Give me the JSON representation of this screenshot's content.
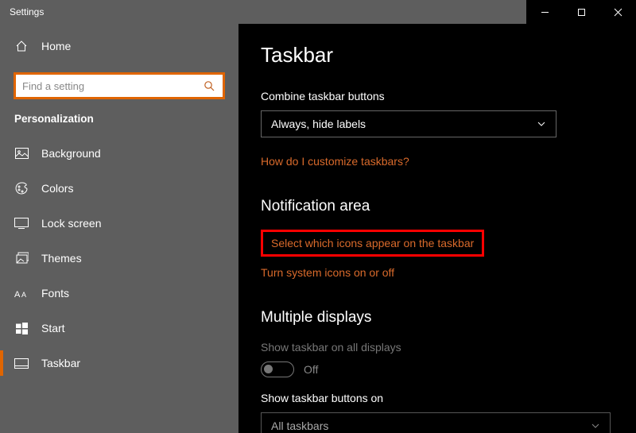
{
  "window": {
    "title": "Settings"
  },
  "titlebar": {
    "minimize_label": "Minimize",
    "maximize_label": "Maximize",
    "close_label": "Close"
  },
  "sidebar": {
    "home_label": "Home",
    "search_placeholder": "Find a setting",
    "section_label": "Personalization",
    "items": [
      {
        "icon": "image-icon",
        "label": "Background"
      },
      {
        "icon": "palette-icon",
        "label": "Colors"
      },
      {
        "icon": "lockscreen-icon",
        "label": "Lock screen"
      },
      {
        "icon": "themes-icon",
        "label": "Themes"
      },
      {
        "icon": "fonts-icon",
        "label": "Fonts"
      },
      {
        "icon": "start-icon",
        "label": "Start"
      },
      {
        "icon": "taskbar-icon",
        "label": "Taskbar"
      }
    ],
    "selected_index": 6
  },
  "main": {
    "title": "Taskbar",
    "combine_label": "Combine taskbar buttons",
    "combine_value": "Always, hide labels",
    "customize_link": "How do I customize taskbars?",
    "notification_area": {
      "heading": "Notification area",
      "link_select_icons": "Select which icons appear on the taskbar",
      "link_system_icons": "Turn system icons on or off"
    },
    "multiple_displays": {
      "heading": "Multiple displays",
      "show_taskbar_label": "Show taskbar on all displays",
      "toggle_state": "Off",
      "show_buttons_label": "Show taskbar buttons on",
      "show_buttons_value": "All taskbars"
    }
  },
  "colors": {
    "accent": "#d96a2b",
    "highlight_border": "#ff0000",
    "search_border": "#e06500"
  }
}
